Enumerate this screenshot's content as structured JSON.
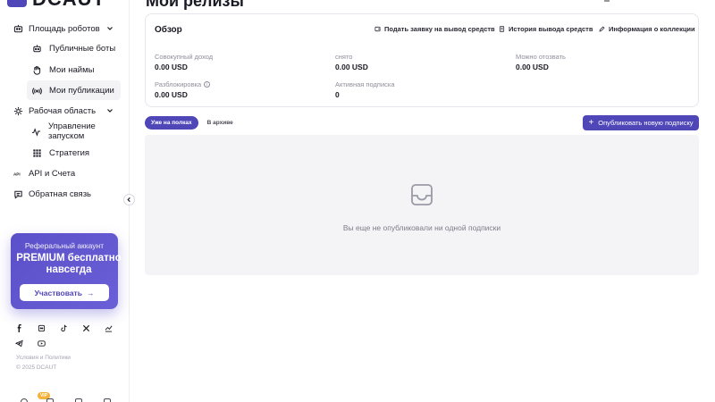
{
  "brand": {
    "name": "DCAUT"
  },
  "page": {
    "title": "Мои релизы"
  },
  "sidebar": {
    "robots_area": {
      "label": "Площадь роботов"
    },
    "public_bots": {
      "label": "Публичные боты"
    },
    "my_hires": {
      "label": "Мои наймы"
    },
    "my_publications": {
      "label": "Мои публикации"
    },
    "workspace": {
      "label": "Рабочая область"
    },
    "launch_mgmt": {
      "label": "Управление запуском"
    },
    "strategy": {
      "label": "Стратегия"
    },
    "api": {
      "label": "API и Счета"
    },
    "feedback": {
      "label": "Обратная связь"
    }
  },
  "promo": {
    "subtitle": "Реферальный аккаунт",
    "title": "PREMIUM бесплатно навсегда",
    "button": "Участвовать",
    "button_icon": "→"
  },
  "footer": {
    "terms": "Условия и Политики",
    "copyright": "© 2025 DCAUT",
    "vip_badge": "VIP"
  },
  "overview": {
    "title": "Обзор",
    "actions": {
      "withdraw": "Подать заявку на вывод средств",
      "history": "История вывода средств",
      "collection": "Информация о коллекции"
    },
    "stats": {
      "total_income": {
        "label": "Совокупный доход",
        "value": "0.00 USD"
      },
      "withdrawn": {
        "label": "снято",
        "value": "0.00 USD"
      },
      "withdrawable": {
        "label": "Можно отозвать",
        "value": "0.00 USD"
      },
      "unlock": {
        "label": "Разблокировка",
        "value": "0.00 USD"
      },
      "active_subs": {
        "label": "Активная подписка",
        "value": "0"
      }
    }
  },
  "tabs": {
    "published": "Уже на полках",
    "archived": "В архиве"
  },
  "publish_button": {
    "label": "Опубликовать новую подписку",
    "icon": "+"
  },
  "empty_state": {
    "text": "Вы еще не опубликовали ни одной подписки"
  },
  "colors": {
    "accent": "#4f46b8",
    "empty_bg": "#f4f4f7",
    "vip": "#f5b23a"
  }
}
